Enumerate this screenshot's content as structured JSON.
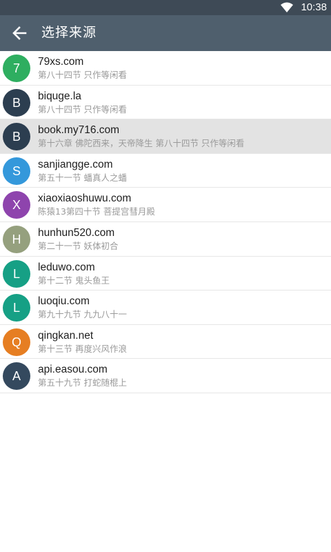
{
  "status_bar": {
    "time": "10:38",
    "wifi_icon": "wifi-icon"
  },
  "app_bar": {
    "back_icon": "arrow-left-icon",
    "title": "选择来源"
  },
  "sources": [
    {
      "letter": "7",
      "name": "79xs.com",
      "chapter": "第八十四节 只作等闲看",
      "color": "#2eae60",
      "selected": false
    },
    {
      "letter": "B",
      "name": "biquge.la",
      "chapter": "第八十四节 只作等闲看",
      "color": "#2c3e50",
      "selected": false
    },
    {
      "letter": "B",
      "name": "book.my716.com",
      "chapter": "第十六章 佛陀西来，天帝降生 第八十四节 只作等闲看",
      "color": "#2c3e50",
      "selected": true
    },
    {
      "letter": "S",
      "name": "sanjiangge.com",
      "chapter": "第五十一节 蟠真人之蟠",
      "color": "#3498db",
      "selected": false
    },
    {
      "letter": "X",
      "name": "xiaoxiaoshuwu.com",
      "chapter": "陈猿13第四十节 菩提宫彗月殿",
      "color": "#8e44ad",
      "selected": false
    },
    {
      "letter": "H",
      "name": "hunhun520.com",
      "chapter": "第二十一节 妖体初合",
      "color": "#95a07e",
      "selected": false
    },
    {
      "letter": "L",
      "name": "leduwo.com",
      "chapter": "第十二节 鬼头鱼王",
      "color": "#16a085",
      "selected": false
    },
    {
      "letter": "L",
      "name": "luoqiu.com",
      "chapter": "第九十九节 九九八十一",
      "color": "#16a085",
      "selected": false
    },
    {
      "letter": "Q",
      "name": "qingkan.net",
      "chapter": "第十三节 再度兴风作浪",
      "color": "#e67e22",
      "selected": false
    },
    {
      "letter": "A",
      "name": "api.easou.com",
      "chapter": "第五十九节 打蛇随棍上",
      "color": "#34495e",
      "selected": false
    }
  ]
}
